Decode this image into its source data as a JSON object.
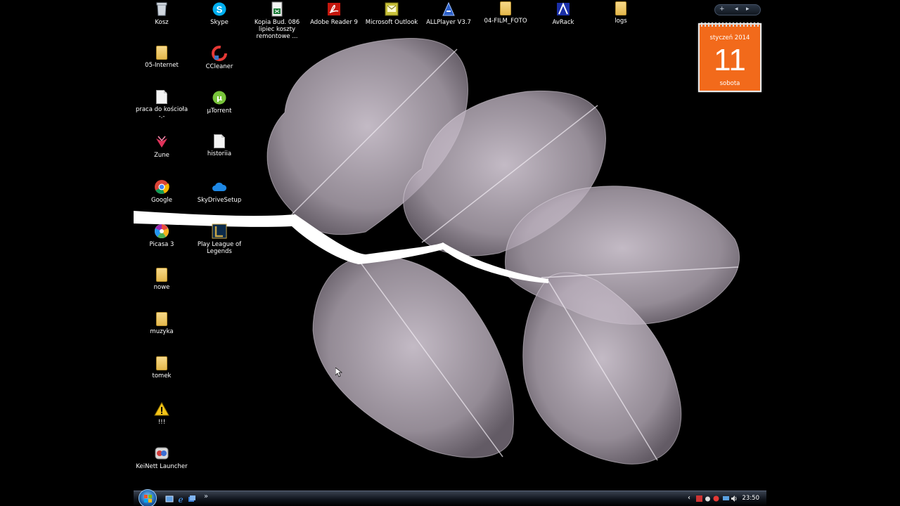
{
  "desktop": {
    "icons": [
      {
        "id": "kosz",
        "label": "Kosz",
        "icon": "recycle-bin-icon"
      },
      {
        "id": "skype",
        "label": "Skype",
        "icon": "skype-icon"
      },
      {
        "id": "kopia",
        "label": "Kopia Bud. 086 lipiec koszty remontowe ...",
        "icon": "spreadsheet-icon"
      },
      {
        "id": "adobe",
        "label": "Adobe Reader 9",
        "icon": "adobe-reader-icon"
      },
      {
        "id": "outlook",
        "label": "Microsoft Outlook",
        "icon": "outlook-icon"
      },
      {
        "id": "allplayer",
        "label": "ALLPlayer V3.7",
        "icon": "allplayer-icon"
      },
      {
        "id": "filmfoto",
        "label": "04-FILM_FOTO",
        "icon": "folder-icon"
      },
      {
        "id": "avrack",
        "label": "AvRack",
        "icon": "avrack-icon"
      },
      {
        "id": "logs",
        "label": "logs",
        "icon": "folder-icon"
      },
      {
        "id": "internet",
        "label": "05-Internet",
        "icon": "folder-icon"
      },
      {
        "id": "ccleaner",
        "label": "CCleaner",
        "icon": "ccleaner-icon"
      },
      {
        "id": "praca",
        "label": "praca do kościoła -.-",
        "icon": "document-icon"
      },
      {
        "id": "utorrent",
        "label": "µTorrent",
        "icon": "utorrent-icon"
      },
      {
        "id": "zune",
        "label": "Zune",
        "icon": "zune-icon"
      },
      {
        "id": "historiia",
        "label": "historiia",
        "icon": "document-icon"
      },
      {
        "id": "google",
        "label": "Google",
        "icon": "chrome-icon"
      },
      {
        "id": "skydrive",
        "label": "SkyDriveSetup",
        "icon": "skydrive-cloud-icon"
      },
      {
        "id": "picasa",
        "label": "Picasa 3",
        "icon": "picasa-icon"
      },
      {
        "id": "lol",
        "label": "Play League of Legends",
        "icon": "league-of-legends-icon"
      },
      {
        "id": "nowe",
        "label": "nowe",
        "icon": "folder-icon"
      },
      {
        "id": "muzyka",
        "label": "muzyka",
        "icon": "folder-icon"
      },
      {
        "id": "tomek",
        "label": "tomek",
        "icon": "folder-icon"
      },
      {
        "id": "warning",
        "label": "!!!",
        "icon": "warning-icon"
      },
      {
        "id": "keinett",
        "label": "KeiNett Launcher",
        "icon": "keinett-launcher-icon"
      }
    ]
  },
  "calendar_gadget": {
    "month_year": "styczeń 2014",
    "day": "11",
    "weekday": "sobota",
    "accent": "#f26a1b"
  },
  "sidebar": {
    "add_label": "+",
    "prev_label": "◂",
    "next_label": "▸"
  },
  "taskbar": {
    "chevron_label": "»",
    "tray_expand_label": "‹",
    "clock": "23:50",
    "start_icon": "windows-start-orb-icon"
  }
}
